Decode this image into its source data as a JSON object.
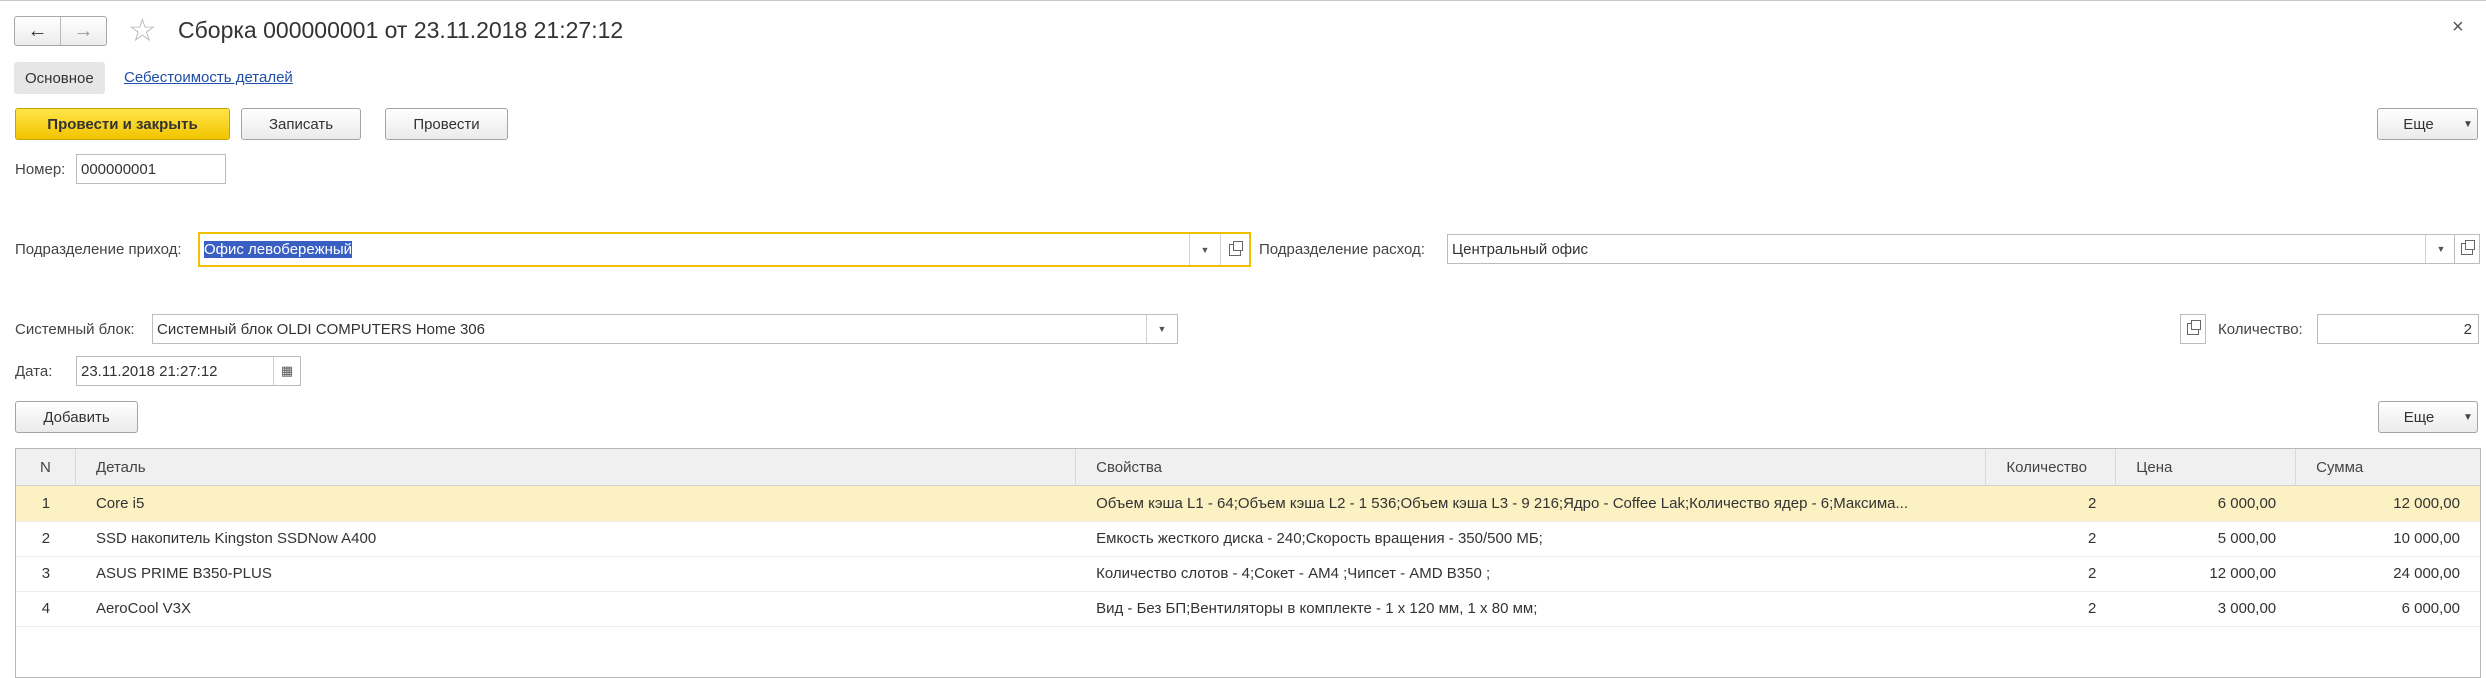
{
  "window": {
    "title": "Сборка 000000001 от 23.11.2018 21:27:12",
    "back_icon": "←",
    "forward_icon": "→",
    "star_icon": "☆",
    "close_icon": "×"
  },
  "tabs": {
    "main": "Основное",
    "cost": "Себестоимость деталей"
  },
  "toolbar": {
    "post_close": "Провести и закрыть",
    "save": "Записать",
    "post": "Провести",
    "more": "Еще"
  },
  "form": {
    "number_label": "Номер:",
    "number_value": "000000001",
    "income_dept_label": "Подразделение приход:",
    "income_dept_value": "Офис левобережный",
    "expense_dept_label": "Подразделение расход:",
    "expense_dept_value": "Центральный офис",
    "system_unit_label": "Системный блок:",
    "system_unit_value": "Системный блок OLDI COMPUTERS Home 306",
    "quantity_label": "Количество:",
    "quantity_value": "2",
    "date_label": "Дата:",
    "date_value": "23.11.2018 21:27:12"
  },
  "table_toolbar": {
    "add": "Добавить",
    "more": "Еще"
  },
  "table": {
    "columns": [
      "N",
      "Деталь",
      "Свойства",
      "Количество",
      "Цена",
      "Сумма"
    ],
    "rows": [
      {
        "n": "1",
        "part": "Core i5",
        "props": "Объем кэша L1 -  64;Объем кэша L2 -  1 536;Объем кэша L3 -  9 216;Ядро -  Coffee Lak;Количество ядер -  6;Максима...",
        "qty": "2",
        "price": "6 000,00",
        "sum": "12 000,00"
      },
      {
        "n": "2",
        "part": "SSD накопитель Kingston SSDNow A400",
        "props": "Емкость жесткого диска -  240;Скорость вращения -  350/500 МБ;",
        "qty": "2",
        "price": "5 000,00",
        "sum": "10 000,00"
      },
      {
        "n": "3",
        "part": "ASUS PRIME B350-PLUS",
        "props": "Количество слотов -  4;Сокет -  AM4 ;Чипсет -  AMD B350 ;",
        "qty": "2",
        "price": "12 000,00",
        "sum": "24 000,00"
      },
      {
        "n": "4",
        "part": "AeroCool V3X",
        "props": "Вид -  Без БП;Вентиляторы в комплекте -  1 x 120 мм, 1 x 80 мм;",
        "qty": "2",
        "price": "3 000,00",
        "sum": "6 000,00"
      }
    ]
  },
  "colors": {
    "primary": "#f5cd00",
    "focus": "#f0c000",
    "selection": "#3a5fc2",
    "row_highlight": "#fbf1c2",
    "link": "#1e4fa8"
  }
}
